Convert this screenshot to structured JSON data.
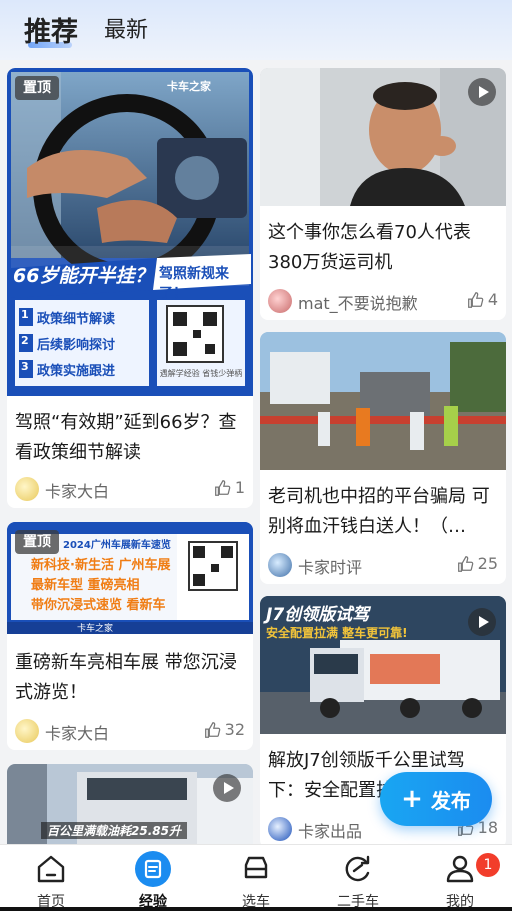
{
  "tabs": {
    "recommend": "推荐",
    "latest": "最新"
  },
  "cards": [
    {
      "badge": "置顶",
      "title": "驾照“有效期”延到66岁？查看政策细节解读",
      "author": "卡家大白",
      "likes": "1",
      "poster": {
        "brand": "卡车之家",
        "headline": "66岁能开半挂？",
        "tag": "驾照新规来了！",
        "points": [
          "政策细节解读",
          "后续影响探讨",
          "政策实施跟进"
        ],
        "qr_caption": "遇解学经验 省钱少弹柄"
      }
    },
    {
      "badge": "置顶",
      "title": "重磅新车亮相车展 带您沉浸式游览！",
      "author": "卡家大白",
      "likes": "32",
      "poster": {
        "top": "2024广州车展新车速览",
        "line1": "新科技·新生活 广州车展",
        "line2": "最新车型 重磅亮相",
        "line3": "带你沉浸式速览 看新车",
        "brand": "卡车之家"
      }
    },
    {
      "title": "",
      "poster": {
        "caption": "百公里满载油耗25.85升"
      }
    },
    {
      "title": "这个事你怎么看70人代表380万货运司机",
      "author": "mat_不要说抱歉",
      "likes": "4"
    },
    {
      "title": "老司机也中招的平台骗局 可别将血汗钱白送人！（…",
      "author": "卡家时评",
      "likes": "25"
    },
    {
      "title": "解放J7创领版千公里试驾下：安全配置拉满 整车更可靠！",
      "author": "卡家出品",
      "likes": "18",
      "poster": {
        "title": "J7创领版试驾",
        "subtitle": "安全配置拉满 整车更可靠!"
      }
    }
  ],
  "fab": {
    "label": "发布"
  },
  "nav": [
    {
      "label": "首页"
    },
    {
      "label": "经验"
    },
    {
      "label": "选车"
    },
    {
      "label": "二手车"
    },
    {
      "label": "我的",
      "badge": "1"
    }
  ],
  "colors": {
    "accent": "#1b8cf0",
    "badge_red": "#f23d2b",
    "poster_blue": "#1a4fb8",
    "poster_orange": "#f07d14"
  }
}
